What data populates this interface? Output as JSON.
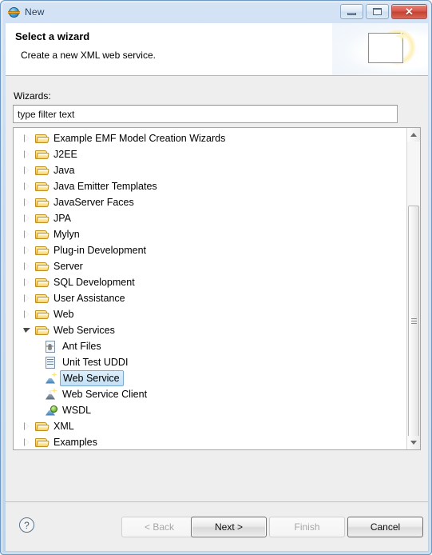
{
  "window": {
    "title": "New",
    "icon": "eclipse-globe-icon",
    "controls": {
      "minimize": "minimize-icon",
      "maximize": "maximize-icon",
      "close": "✕"
    }
  },
  "header": {
    "title": "Select a wizard",
    "description": "Create a new XML web service.",
    "art_icon": "wizard-sparkle-icon"
  },
  "form": {
    "wizards_label": "Wizards:",
    "filter_value": "type filter text",
    "filter_placeholder": "type filter text"
  },
  "tree": {
    "items": [
      {
        "label": "Example EMF Model Creation Wizards",
        "type": "folder",
        "state": "collapsed",
        "level": 0,
        "selected": false
      },
      {
        "label": "J2EE",
        "type": "folder",
        "state": "collapsed",
        "level": 0,
        "selected": false
      },
      {
        "label": "Java",
        "type": "folder",
        "state": "collapsed",
        "level": 0,
        "selected": false
      },
      {
        "label": "Java Emitter Templates",
        "type": "folder",
        "state": "collapsed",
        "level": 0,
        "selected": false
      },
      {
        "label": "JavaServer Faces",
        "type": "folder",
        "state": "collapsed",
        "level": 0,
        "selected": false
      },
      {
        "label": "JPA",
        "type": "folder",
        "state": "collapsed",
        "level": 0,
        "selected": false
      },
      {
        "label": "Mylyn",
        "type": "folder",
        "state": "collapsed",
        "level": 0,
        "selected": false
      },
      {
        "label": "Plug-in Development",
        "type": "folder",
        "state": "collapsed",
        "level": 0,
        "selected": false
      },
      {
        "label": "Server",
        "type": "folder",
        "state": "collapsed",
        "level": 0,
        "selected": false
      },
      {
        "label": "SQL Development",
        "type": "folder",
        "state": "collapsed",
        "level": 0,
        "selected": false
      },
      {
        "label": "User Assistance",
        "type": "folder",
        "state": "collapsed",
        "level": 0,
        "selected": false
      },
      {
        "label": "Web",
        "type": "folder",
        "state": "collapsed",
        "level": 0,
        "selected": false
      },
      {
        "label": "Web Services",
        "type": "folder",
        "state": "expanded",
        "level": 0,
        "selected": false
      },
      {
        "label": "Ant Files",
        "type": "ant-file",
        "state": "leaf",
        "level": 1,
        "selected": false
      },
      {
        "label": "Unit Test UDDI",
        "type": "uddi-document",
        "state": "leaf",
        "level": 1,
        "selected": false
      },
      {
        "label": "Web Service",
        "type": "web-service",
        "state": "leaf",
        "level": 1,
        "selected": true
      },
      {
        "label": "Web Service Client",
        "type": "web-service-client",
        "state": "leaf",
        "level": 1,
        "selected": false
      },
      {
        "label": "WSDL",
        "type": "wsdl",
        "state": "leaf",
        "level": 1,
        "selected": false
      },
      {
        "label": "XML",
        "type": "folder",
        "state": "collapsed",
        "level": 0,
        "selected": false
      },
      {
        "label": "Examples",
        "type": "folder",
        "state": "collapsed",
        "level": 0,
        "selected": false
      }
    ],
    "scrollbar": {
      "up_arrow": "scroll-up-icon",
      "down_arrow": "scroll-down-icon"
    }
  },
  "footer": {
    "help_icon": "?",
    "buttons": [
      {
        "id": "back",
        "label": "< Back",
        "enabled": false,
        "default": false
      },
      {
        "id": "next",
        "label": "Next >",
        "enabled": true,
        "default": true
      },
      {
        "id": "finish",
        "label": "Finish",
        "enabled": false,
        "default": false
      },
      {
        "id": "cancel",
        "label": "Cancel",
        "enabled": true,
        "default": false
      }
    ]
  },
  "colors": {
    "window_frame": "#bcd3ea",
    "body_bg": "#eeeeee",
    "header_bg": "#ffffff",
    "selection_bg": "#c2e0f6",
    "selection_border": "#7aa9d0",
    "close_button": "#d9574a"
  }
}
